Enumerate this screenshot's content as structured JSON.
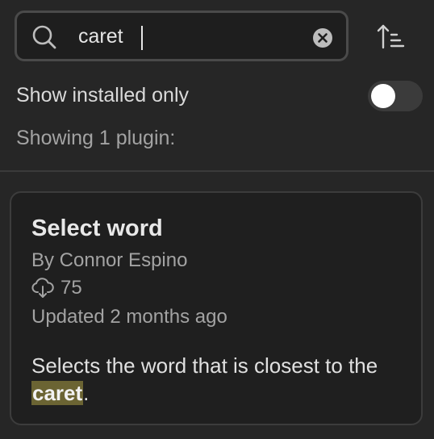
{
  "search": {
    "value": "caret",
    "icon": "search-icon",
    "clear_icon": "clear-circle-icon"
  },
  "sort": {
    "icon": "sort-ascending-icon"
  },
  "filter": {
    "label": "Show installed only",
    "enabled": false
  },
  "results": {
    "count_text": "Showing 1 plugin:"
  },
  "plugins": [
    {
      "title": "Select word",
      "author": "By Connor Espino",
      "downloads": "75",
      "download_icon": "download-cloud-icon",
      "updated": "Updated 2 months ago",
      "description_before": "Selects the word that is closest to the ",
      "description_match": "caret",
      "description_after": ".",
      "highlight_color": "#6b6433"
    }
  ],
  "colors": {
    "background": "#262626",
    "card_background": "#1f1f1f",
    "text_primary": "#dadada",
    "text_muted": "#a3a3a3"
  }
}
